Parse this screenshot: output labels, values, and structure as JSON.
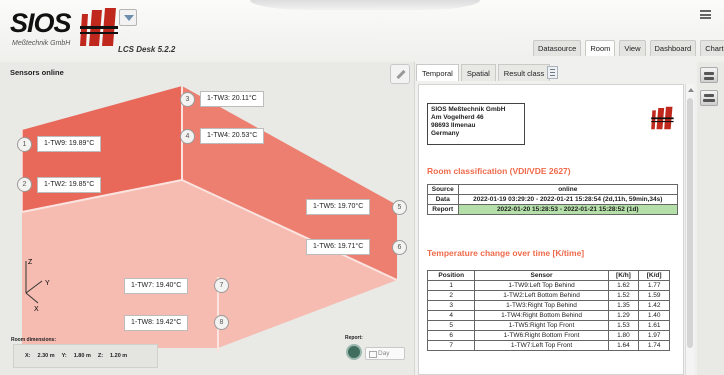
{
  "header": {
    "brand": "SIOS",
    "brand_subtitle": "Meßtechnik GmbH",
    "app_title": "LCS Desk 5.2.2",
    "nav_tabs": [
      "Datasource",
      "Room",
      "View",
      "Dashboard",
      "Chart"
    ],
    "active_nav_tab": "Room"
  },
  "left": {
    "title": "Sensors online",
    "sensors": [
      {
        "num": "1",
        "label": "1-TW9: 19.89°C"
      },
      {
        "num": "2",
        "label": "1-TW2: 19.85°C"
      },
      {
        "num": "3",
        "label": "1-TW3: 20.11°C"
      },
      {
        "num": "4",
        "label": "1-TW4: 20.53°C"
      },
      {
        "num": "5",
        "label": "1-TW5: 19.70°C"
      },
      {
        "num": "6",
        "label": "1-TW6: 19.71°C"
      },
      {
        "num": "7",
        "label": "1-TW7: 19.40°C"
      },
      {
        "num": "8",
        "label": "1-TW8: 19.42°C"
      }
    ],
    "axes": {
      "z": "Z",
      "y": "Y",
      "x": "X"
    },
    "room_dimensions": {
      "title": "Room dimensions:",
      "x_label": "X:",
      "x_value": "2.30 m",
      "y_label": "Y:",
      "y_value": "1.80 m",
      "z_label": "Z:",
      "z_value": "1.20 m"
    },
    "report": {
      "label": "Report:",
      "select_value": "Day"
    }
  },
  "right": {
    "sub_tabs": [
      "Temporal",
      "Spatial",
      "Result class"
    ],
    "active_sub_tab": "Temporal",
    "address": [
      "SIOS Meßtechnik GmbH",
      "Am Vogelherd 46",
      "98693 Ilmenau",
      "Germany"
    ],
    "room_classification": {
      "title": "Room classification (VDI/VDE 2627)",
      "col_source": "Source",
      "col_online": "online",
      "data_label": "Data",
      "data_value": "2022-01-19 03:29:20 - 2022-01-21 15:28:54 (2d,11h, 59min,34s)",
      "report_label": "Report",
      "report_value": "2022-01-20 15:28:53 - 2022-01-21 15:28:52 (1d)"
    },
    "temperature_change": {
      "title": "Temperature change over time [K/time]",
      "headers": [
        "Position",
        "Sensor",
        "[K/h]",
        "[K/d]"
      ],
      "rows": [
        [
          "1",
          "1-TW9:Left Top Behind",
          "1.62",
          "1.77"
        ],
        [
          "2",
          "1-TW2:Left Bottom Behind",
          "1.52",
          "1.59"
        ],
        [
          "3",
          "1-TW3:Right Top Behind",
          "1.35",
          "1.42"
        ],
        [
          "4",
          "1-TW4:Right Bottom Behind",
          "1.29",
          "1.40"
        ],
        [
          "5",
          "1-TW5:Right Top Front",
          "1.53",
          "1.61"
        ],
        [
          "6",
          "1-TW6:Right Bottom Front",
          "1.80",
          "1.97"
        ],
        [
          "7",
          "1-TW7:Left Top Front",
          "1.64",
          "1.74"
        ]
      ]
    }
  },
  "colors": {
    "room_face_dark": "#e8695a",
    "room_face_light": "#f2a99e",
    "room_floor": "#f5b8ae",
    "section_title": "#ee6a4a",
    "report_row": "#b4dfa8"
  },
  "icons": [
    "dropdown-icon",
    "menu-icon",
    "edit-icon",
    "document-icon",
    "report-icon",
    "calendar-icon",
    "print-icon",
    "storage-icon"
  ]
}
